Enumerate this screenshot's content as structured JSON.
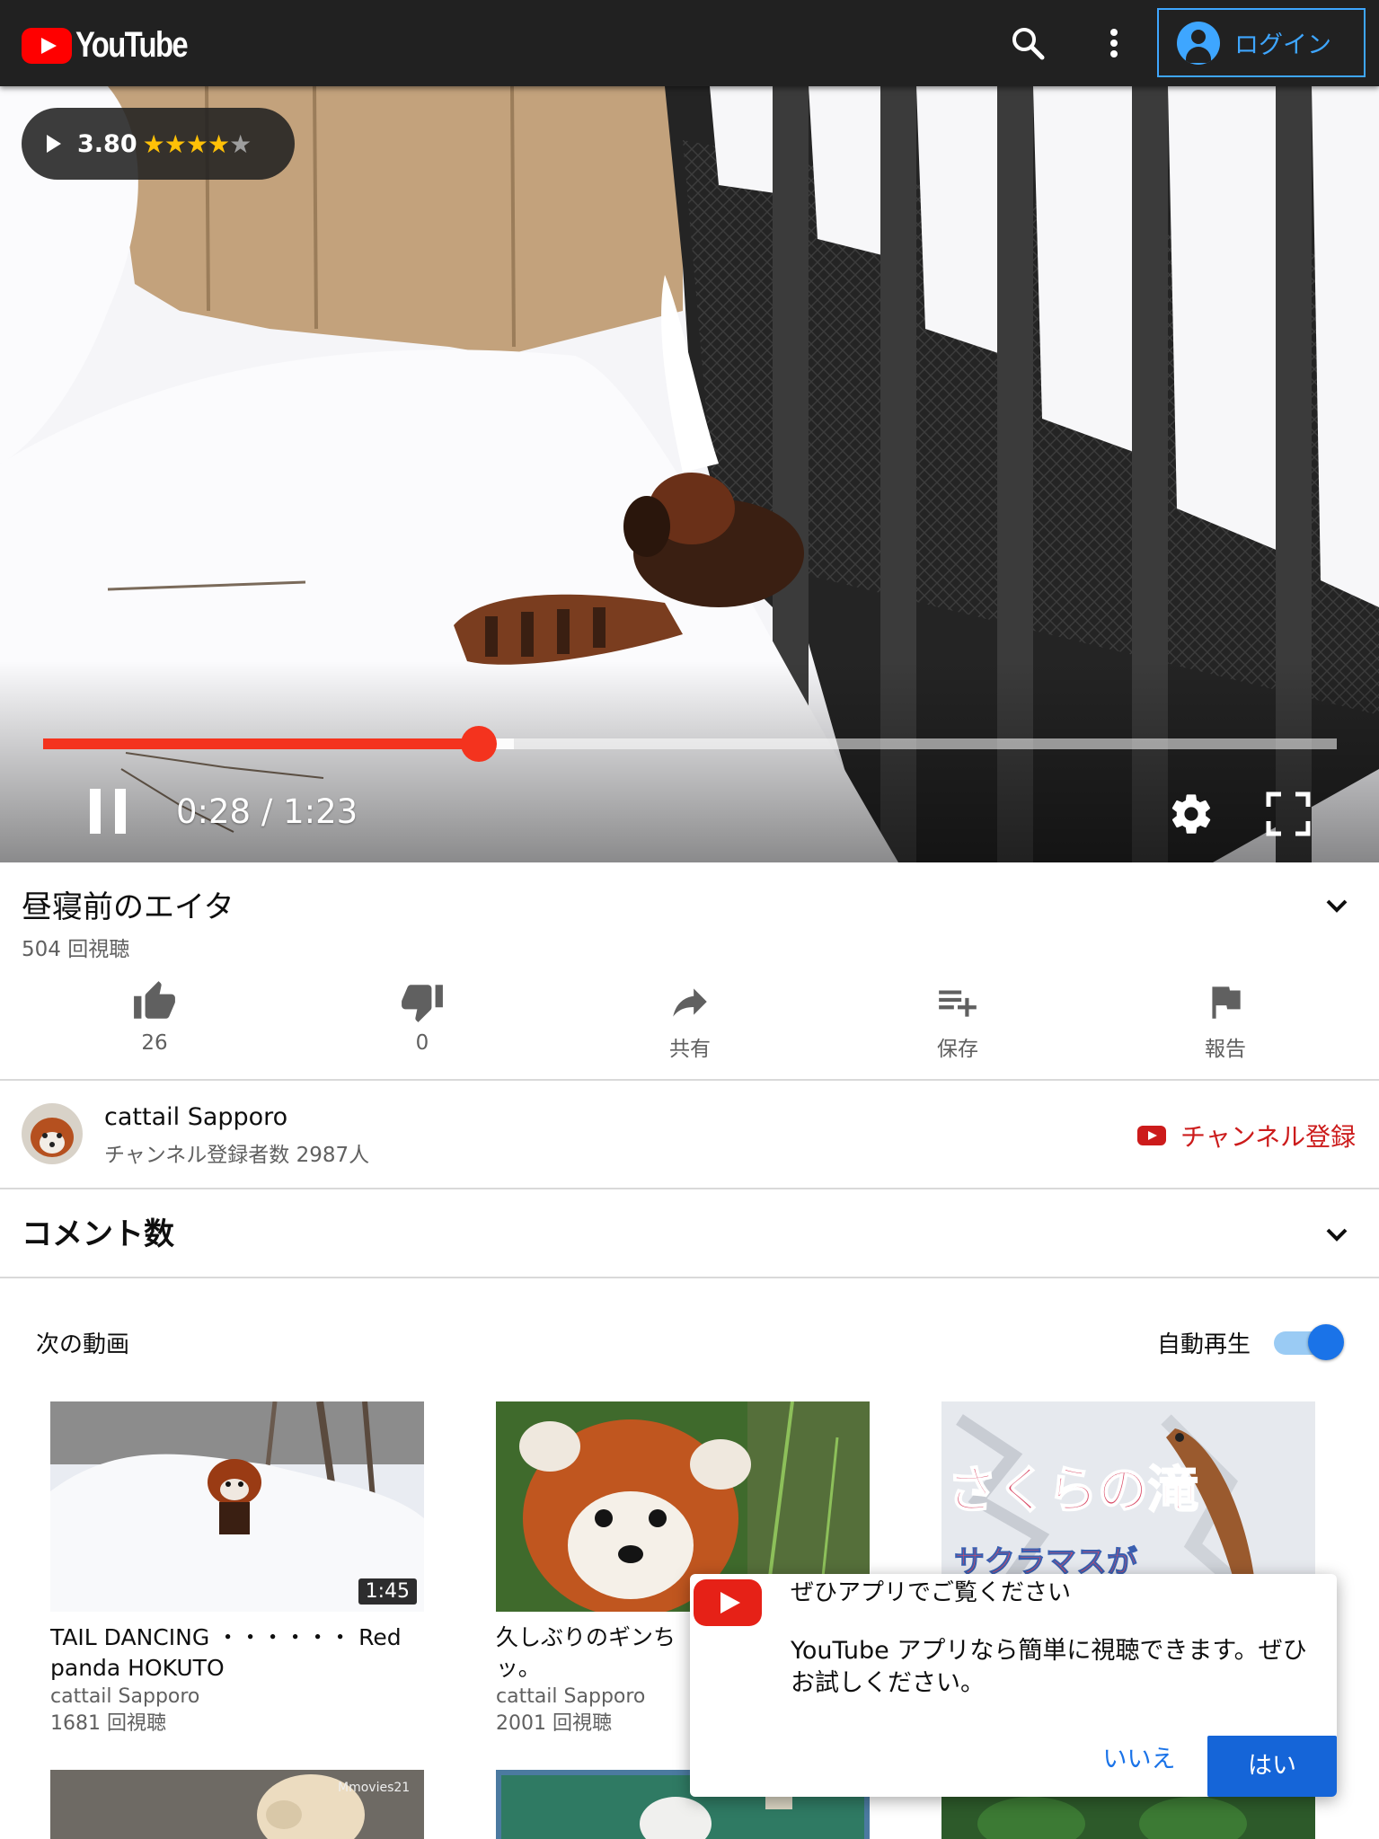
{
  "header": {
    "logo_text": "YouTube",
    "search_icon": "search-icon",
    "menu_icon": "more-vert-icon",
    "login_label": "ログイン",
    "brand_color": "#ff0000",
    "accent_color": "#3ea6ff"
  },
  "player": {
    "rating_score": "3.80",
    "rating_stars": 4,
    "rating_max": 5,
    "current_time": "0:28",
    "separator": "/",
    "duration": "1:23",
    "progress_fraction": 0.337,
    "buffered_fraction": 0.364,
    "progress_color": "#f4331e"
  },
  "video": {
    "title": "昼寝前のエイタ",
    "views": "504 回視聴"
  },
  "actions": [
    {
      "icon": "thumb-up-icon",
      "label": "26"
    },
    {
      "icon": "thumb-down-icon",
      "label": "0"
    },
    {
      "icon": "share-icon",
      "label": "共有"
    },
    {
      "icon": "playlist-add-icon",
      "label": "保存"
    },
    {
      "icon": "flag-icon",
      "label": "報告"
    }
  ],
  "channel": {
    "name": "cattail Sapporo",
    "subscribers": "チャンネル登録者数 2987人",
    "subscribe_label": "チャンネル登録",
    "subscribe_color": "#cc1b1b"
  },
  "comments": {
    "label": "コメント数"
  },
  "up_next": {
    "label": "次の動画",
    "autoplay_label": "自動再生",
    "autoplay_on": true,
    "videos": [
      {
        "title": "TAIL DANCING ・・・・・・ Red panda HOKUTO",
        "channel": "cattail Sapporo",
        "views": "1681 回視聴",
        "duration": "1:45"
      },
      {
        "title": "久しぶりのギンち\nッ。",
        "channel": "cattail Sapporo",
        "views": "2001 回視聴",
        "duration": ""
      },
      {
        "title": "",
        "channel": "",
        "views": "",
        "duration": "",
        "thumb_text_1": "さくらの滝",
        "thumb_text_2": "サクラマスが"
      }
    ],
    "watermark": "Mmovies21"
  },
  "app_promo": {
    "title": "ぜひアプリでご覧ください",
    "body": "YouTube アプリなら簡単に視聴できます。ぜひお試しください。",
    "no_label": "いいえ",
    "yes_label": "はい"
  }
}
